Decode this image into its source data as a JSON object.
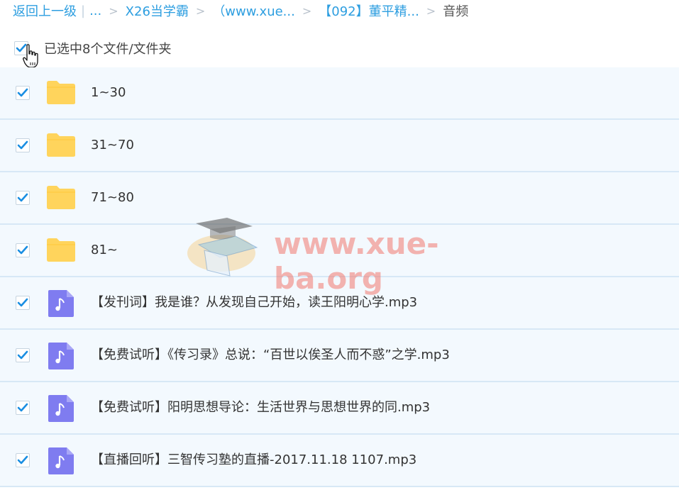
{
  "breadcrumb": {
    "back": "返回上一级",
    "ellipsis": "...",
    "items": [
      "X26当学霸",
      "（www.xue...",
      "【092】董平精...",
      "音频"
    ]
  },
  "selection": {
    "label": "已选中8个文件/文件夹",
    "checked": true
  },
  "files": [
    {
      "name": "1~30",
      "type": "folder",
      "checked": true
    },
    {
      "name": "31~70",
      "type": "folder",
      "checked": true
    },
    {
      "name": "71~80",
      "type": "folder",
      "checked": true
    },
    {
      "name": "81~",
      "type": "folder",
      "checked": true
    },
    {
      "name": "【发刊词】我是谁？从发现自己开始，读王阳明心学.mp3",
      "type": "audio",
      "checked": true
    },
    {
      "name": "【免费试听】《传习录》总说：“百世以俟圣人而不惑”之学.mp3",
      "type": "audio",
      "checked": true
    },
    {
      "name": "【免费试听】阳明思想导论：生活世界与思想世界的同.mp3",
      "type": "audio",
      "checked": true
    },
    {
      "name": "【直播回听】三智传习塾的直播-2017.11.18 1107.mp3",
      "type": "audio",
      "checked": true
    }
  ],
  "watermark": {
    "text": "www.xue-ba.org"
  },
  "colors": {
    "link": "#2d9ee0",
    "check": "#1a8ee2",
    "folder": "#ffd45c",
    "audio": "#7f7cf0",
    "row_bg": "#f3f9fe",
    "row_border": "#d7e8f6"
  }
}
